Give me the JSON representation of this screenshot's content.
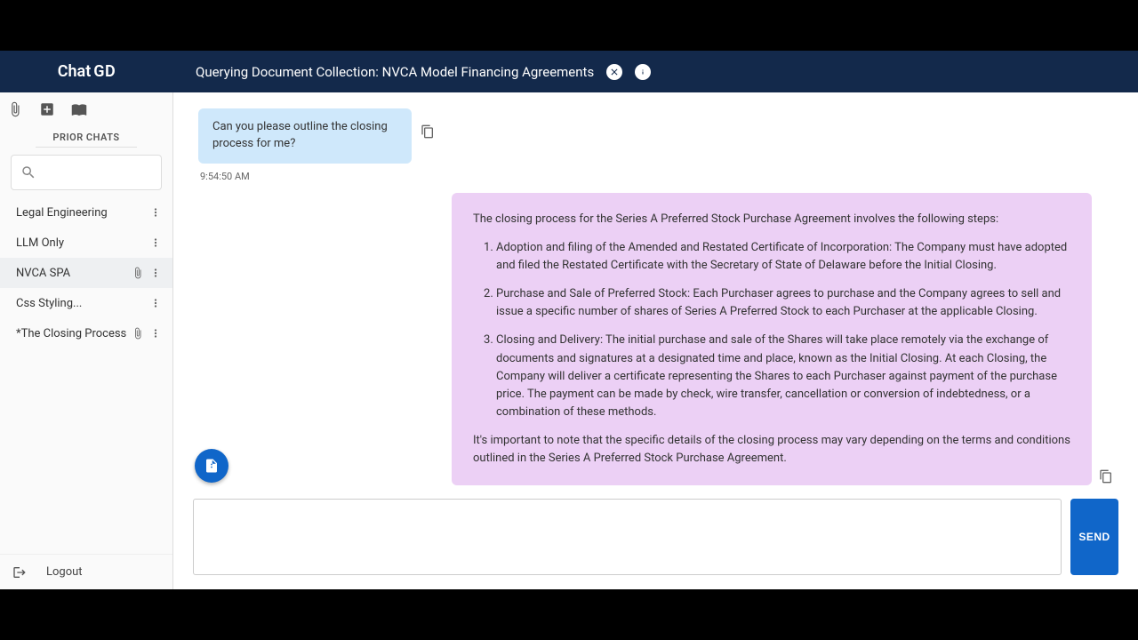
{
  "app": {
    "logo_text": "Chat",
    "logo_suffix": "GD"
  },
  "header": {
    "title": "Querying Document Collection: NVCA Model Financing Agreements",
    "close_icon": "close",
    "info_icon": "info"
  },
  "sidebar": {
    "section_label": "PRIOR CHATS",
    "search_placeholder": "",
    "items": [
      {
        "name": "Legal Engineering",
        "has_attachment": false,
        "active": false
      },
      {
        "name": "LLM Only",
        "has_attachment": false,
        "active": false
      },
      {
        "name": "NVCA SPA",
        "has_attachment": true,
        "active": true
      },
      {
        "name": "Css Styling...",
        "has_attachment": false,
        "active": false
      },
      {
        "name": "*The Closing Process",
        "has_attachment": true,
        "active": false
      }
    ],
    "logout_label": "Logout"
  },
  "conversation": {
    "user_message": "Can you please outline the closing process for me?",
    "user_timestamp": "9:54:50 AM",
    "assistant_intro": "The closing process for the Series A Preferred Stock Purchase Agreement involves the following steps:",
    "assistant_steps": [
      "Adoption and filing of the Amended and Restated Certificate of Incorporation: The Company must have adopted and filed the Restated Certificate with the Secretary of State of Delaware before the Initial Closing.",
      "Purchase and Sale of Preferred Stock: Each Purchaser agrees to purchase and the Company agrees to sell and issue a specific number of shares of Series A Preferred Stock to each Purchaser at the applicable Closing.",
      "Closing and Delivery: The initial purchase and sale of the Shares will take place remotely via the exchange of documents and signatures at a designated time and place, known as the Initial Closing. At each Closing, the Company will deliver a certificate representing the Shares to each Purchaser against payment of the purchase price. The payment can be made by check, wire transfer, cancellation or conversion of indebtedness, or a combination of these methods."
    ],
    "assistant_outro": "It's important to note that the specific details of the closing process may vary depending on the terms and conditions outlined in the Series A Preferred Stock Purchase Agreement."
  },
  "compose": {
    "send_label": "SEND",
    "input_value": ""
  }
}
